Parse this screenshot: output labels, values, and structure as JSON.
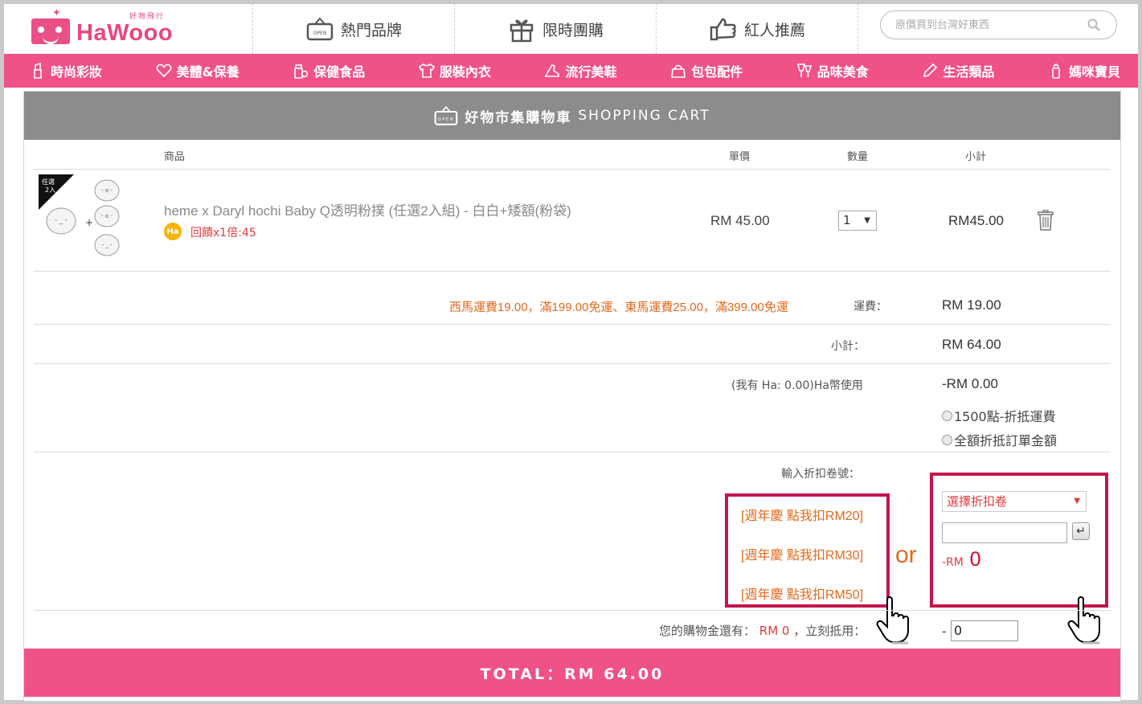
{
  "brand": {
    "logo_text": "HaWooo",
    "logo_sub": "好物飛行"
  },
  "top_nav": [
    {
      "label": "熱門品牌",
      "icon": "open-sign-icon"
    },
    {
      "label": "限時團購",
      "icon": "gift-icon"
    },
    {
      "label": "紅人推薦",
      "icon": "thumbs-up-icon"
    }
  ],
  "search": {
    "placeholder": "原價買到台灣好東西",
    "icon": "search-icon"
  },
  "categories": [
    {
      "label": "時尚彩妝",
      "icon": "lipstick-icon"
    },
    {
      "label": "美體&保養",
      "icon": "heart-icon"
    },
    {
      "label": "保健食品",
      "icon": "supplement-icon"
    },
    {
      "label": "服裝內衣",
      "icon": "shirt-icon"
    },
    {
      "label": "流行美鞋",
      "icon": "heel-icon"
    },
    {
      "label": "包包配件",
      "icon": "bag-icon"
    },
    {
      "label": "品味美食",
      "icon": "drink-icon"
    },
    {
      "label": "生活類品",
      "icon": "pencil-icon"
    },
    {
      "label": "媽咪寶貝",
      "icon": "bottle-icon"
    }
  ],
  "cart": {
    "title_cn": "好物市集購物車",
    "title_en": "SHOPPING CART",
    "headers": {
      "product": "商品",
      "unit_price": "單價",
      "quantity": "數量",
      "subtotal": "小計"
    },
    "item": {
      "thumb_tag_line1": "任選",
      "thumb_tag_line2": "2入",
      "name": "heme x Daryl hochi Baby Q透明粉撲 (任選2入組) - 白白+矮額(粉袋)",
      "ha_badge": "Ha",
      "reward": "回饋x1倍:45",
      "price": "RM 45.00",
      "quantity": "1",
      "subtotal": "RM45.00"
    },
    "shipping_note": "西馬運費19.00，滿199.00免運、東馬運費25.00，滿399.00免運",
    "shipping_label": "運費：",
    "shipping_value": "RM 19.00",
    "subtotal_label": "小計：",
    "subtotal_value": "RM 64.00",
    "ha_label": "(我有 Ha: 0.00)Ha幣使用",
    "ha_value": "-RM 0.00",
    "ha_options": [
      "1500點-折抵運費",
      "全額折抵訂單金額"
    ],
    "coupon_label": "輸入折扣卷號：",
    "coupon_links": [
      "[週年慶 點我扣RM20]",
      "[週年慶 點我扣RM30]",
      "[週年慶 點我扣RM50]"
    ],
    "or_text": "or",
    "coupon_select": "選擇折扣卷",
    "enter_symbol": "↵",
    "discount_prefix": "-RM",
    "discount_value": "0",
    "credit_prefix": "您的購物金還有：",
    "credit_amount": "RM 0",
    "credit_suffix": "，立刻抵用：",
    "credit_dash": "-",
    "credit_input": "0",
    "total": "TOTAL：RM 64.00"
  },
  "colors": {
    "accent_pink": "#f05188",
    "highlight_border": "#c4154a",
    "orange_text": "#e36a1c",
    "header_gray": "#8c8c8c"
  }
}
